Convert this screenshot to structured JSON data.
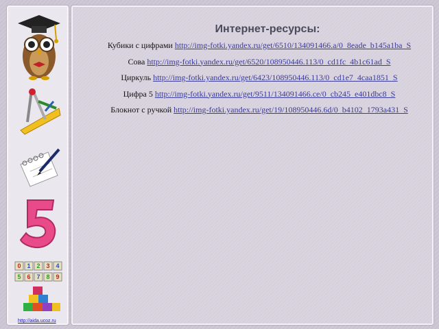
{
  "title": "Интернет-ресурсы:",
  "resources": [
    {
      "label": "Кубики с цифрами ",
      "url": "http://img-fotki.yandex.ru/get/6510/134091466.a/0_8eade_b145a1ba_S"
    },
    {
      "label": "Сова ",
      "url": "http://img-fotki.yandex.ru/get/6520/108950446.113/0_cd1fc_4b1c61ad_S"
    },
    {
      "label": "Циркуль ",
      "url": "http://img-fotki.yandex.ru/get/6423/108950446.113/0_cd1e7_4caa1851_S"
    },
    {
      "label": "Цифра 5 ",
      "url": "http://img-fotki.yandex.ru/get/9511/134091466.ce/0_cb245_e401dbc8_S"
    },
    {
      "label": "Блокнот с ручкой ",
      "url": "http://img-fotki.yandex.ru/get/19/108950446.6d/0_b4102_1793a431_S"
    }
  ],
  "sidebar": {
    "icons": [
      "owl-icon",
      "compass-ruler-icon",
      "notepad-pen-icon",
      "digit-five-icon",
      "number-blocks-icon"
    ],
    "footer_link": "http://aida.ucoz.ru"
  },
  "colors": {
    "link": "#3a3a9a",
    "title": "#4a4a5a",
    "background": "#c9c3d1"
  }
}
